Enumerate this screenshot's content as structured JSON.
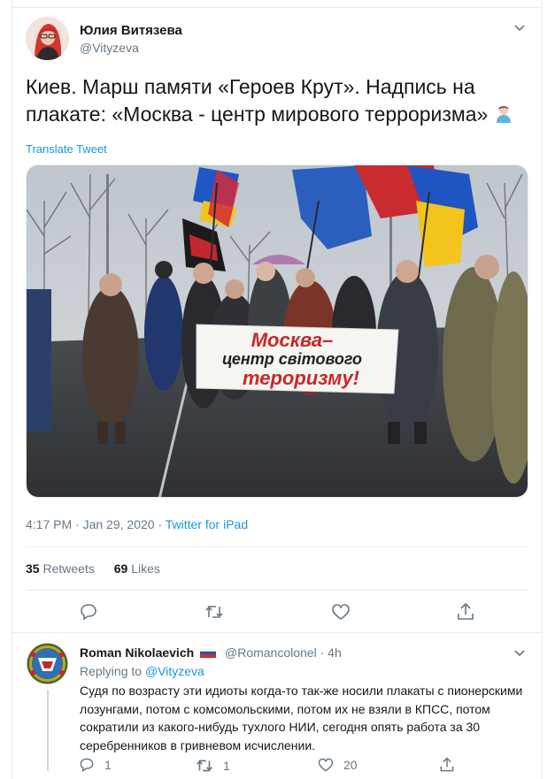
{
  "tweet": {
    "author": {
      "display_name": "Юлия Витязева",
      "handle": "@Vityzeva"
    },
    "text": "Киев. Марш  памяти «Героев Крут». Надпись на плакате: «Москва - центр мирового терроризма»",
    "emoji": "person-facepalming-emoji",
    "translate_label": "Translate Tweet",
    "photo": {
      "banner_line1": "Москва–",
      "banner_line2": "центр світового",
      "banner_line3": "тероризму!"
    },
    "meta": {
      "time": "4:17 PM",
      "separator1": "·",
      "date": "Jan 29, 2020",
      "separator2": "·",
      "source": "Twitter for iPad"
    },
    "stats": {
      "retweets_count": "35",
      "retweets_label": "Retweets",
      "likes_count": "69",
      "likes_label": "Likes"
    },
    "actions": [
      "reply-icon",
      "retweet-icon",
      "like-icon",
      "share-icon"
    ]
  },
  "reply": {
    "author": {
      "display_name": "Roman Nikolaevich",
      "handle": "@Romancolonel",
      "separator": "·",
      "age": "4h"
    },
    "replying_prefix": "Replying to",
    "replying_to": "@Vityzeva",
    "text": "Судя по возрасту эти идиоты когда-то так-же носили плакаты с пионерскими лозунгами, потом с комсомольскими, потом их не взяли в КПСС, потом сократили из  какого-нибудь тухлого НИИ, сегодня опять работа за 30 серебренников в гривневом исчислении.",
    "actions": {
      "reply_count": "1",
      "retweet_count": "1",
      "like_count": "20"
    }
  },
  "colors": {
    "accent": "#1b95e0",
    "muted": "#657786",
    "text": "#14171a",
    "border": "#e6ecf0"
  }
}
